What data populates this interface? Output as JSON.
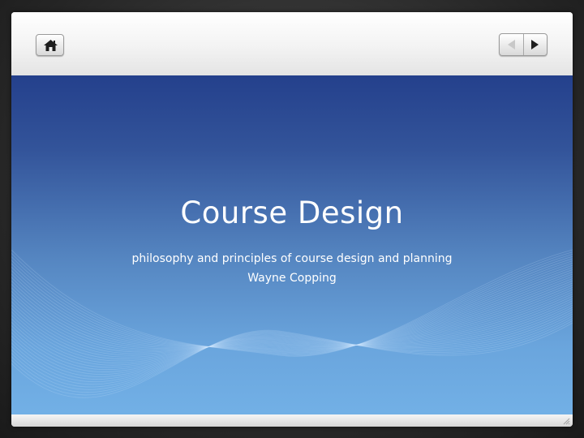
{
  "toolbar": {
    "home_icon": "home-icon",
    "prev_icon": "triangle-left-icon",
    "next_icon": "triangle-right-icon"
  },
  "slide": {
    "title": "Course Design",
    "subtitle_line1": "philosophy and principles of course design and planning",
    "subtitle_line2": "Wayne Copping"
  },
  "colors": {
    "slide_top": "#24408c",
    "slide_bottom": "#72b0e6",
    "frame": "#f2f2f2",
    "text": "#ffffff"
  }
}
